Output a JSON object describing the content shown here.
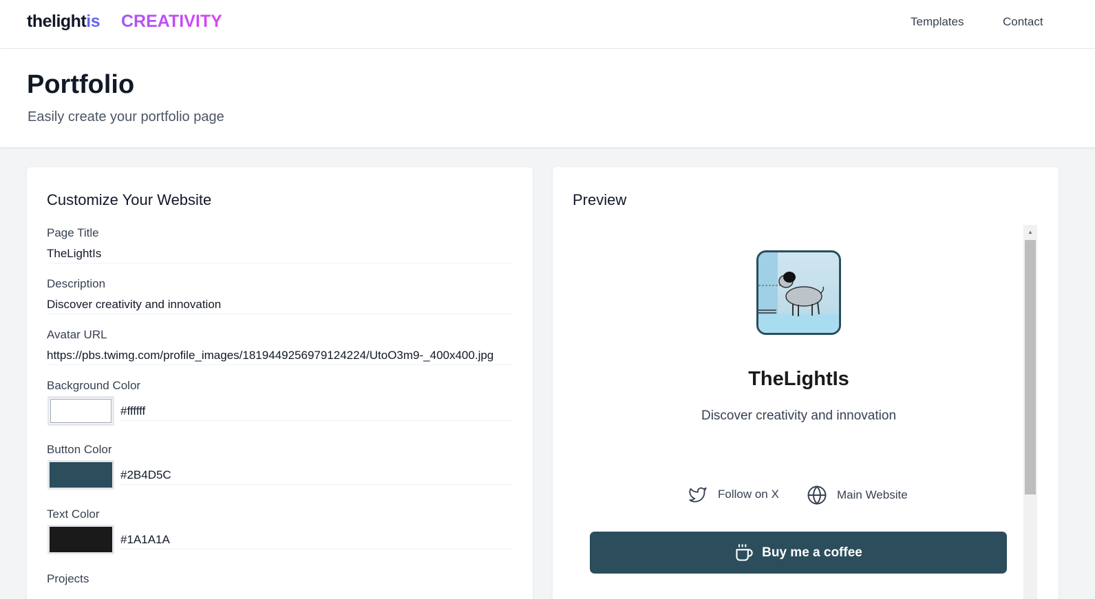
{
  "nav": {
    "brand_main": "thelight",
    "brand_accent": "is",
    "brand_sub": "CREATIVITY",
    "links": [
      "Templates",
      "Contact"
    ]
  },
  "header": {
    "title": "Portfolio",
    "subtitle": "Easily create your portfolio page"
  },
  "form": {
    "heading": "Customize Your Website",
    "page_title_label": "Page Title",
    "page_title_value": "TheLightIs",
    "description_label": "Description",
    "description_value": "Discover creativity and innovation",
    "avatar_label": "Avatar URL",
    "avatar_value": "https://pbs.twimg.com/profile_images/1819449256979124224/UtoO3m9-_400x400.jpg",
    "bg_color_label": "Background Color",
    "bg_color_value": "#ffffff",
    "button_color_label": "Button Color",
    "button_color_value": "#2B4D5C",
    "text_color_label": "Text Color",
    "text_color_value": "#1A1A1A",
    "projects_label": "Projects"
  },
  "preview": {
    "heading": "Preview",
    "name": "TheLightIs",
    "description": "Discover creativity and innovation",
    "social_x": "Follow on X",
    "social_web": "Main Website",
    "coffee_button": "Buy me a coffee",
    "icons": [
      "twitter-bird-icon",
      "globe-icon",
      "coffee-cup-icon"
    ]
  },
  "colors": {
    "brand_accent": "#6366f1",
    "creativity_gradient": [
      "#a855f7",
      "#d946ef"
    ],
    "button": "#2B4D5C",
    "text": "#1A1A1A",
    "background": "#ffffff"
  }
}
